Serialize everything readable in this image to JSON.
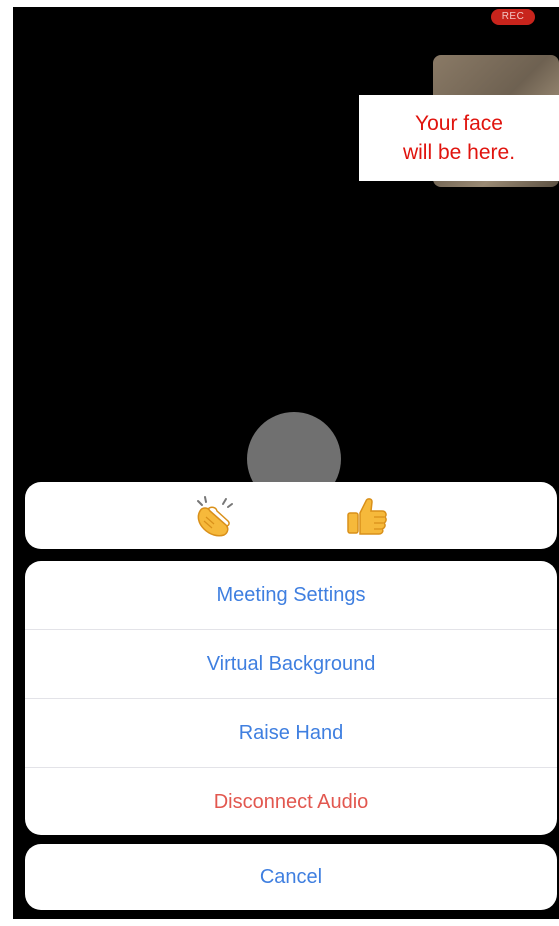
{
  "status_bar": {
    "recording_badge": "REC"
  },
  "video": {
    "self_view_note": "Your face\nwill be here."
  },
  "reactions": [
    {
      "name": "clap",
      "emoji": "👏"
    },
    {
      "name": "thumbs-up",
      "emoji": "👍"
    }
  ],
  "menu": {
    "items": [
      {
        "label": "Meeting Settings"
      },
      {
        "label": "Virtual Background"
      },
      {
        "label": "Raise Hand"
      },
      {
        "label": "Disconnect Audio"
      }
    ],
    "cancel_label": "Cancel"
  },
  "colors": {
    "action_text": "#3f7fe0",
    "destructive_text": "#e2574f",
    "recording_badge": "#c8241c",
    "note_text": "#e0140e"
  }
}
